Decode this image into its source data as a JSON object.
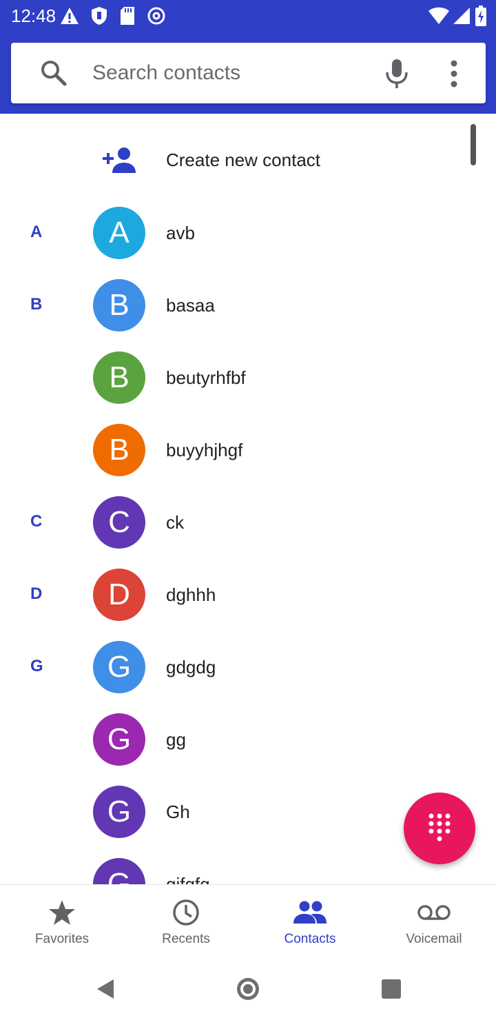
{
  "status_bar": {
    "time": "12:48",
    "left_icons": [
      "alert-icon",
      "shield-icon",
      "sd-card-icon",
      "sync-icon"
    ],
    "right_icons": [
      "wifi-icon",
      "signal-icon",
      "battery-charging-icon"
    ]
  },
  "search": {
    "placeholder": "Search contacts",
    "value": ""
  },
  "create_contact": {
    "label": "Create new contact"
  },
  "contacts": [
    {
      "letter": "A",
      "initial": "A",
      "name": "avb",
      "color": "#1ea8e0"
    },
    {
      "letter": "B",
      "initial": "B",
      "name": "basaa",
      "color": "#3f8ee8"
    },
    {
      "letter": "",
      "initial": "B",
      "name": "beutyrhfbf",
      "color": "#5aa33e"
    },
    {
      "letter": "",
      "initial": "B",
      "name": "buyyhjhgf",
      "color": "#ef6c00"
    },
    {
      "letter": "C",
      "initial": "C",
      "name": "ck",
      "color": "#6237b3"
    },
    {
      "letter": "D",
      "initial": "D",
      "name": "dghhh",
      "color": "#db4437"
    },
    {
      "letter": "G",
      "initial": "G",
      "name": "gdgdg",
      "color": "#3f8ee8"
    },
    {
      "letter": "",
      "initial": "G",
      "name": "gg",
      "color": "#9c27b0"
    },
    {
      "letter": "",
      "initial": "G",
      "name": "Gh",
      "color": "#6237b3"
    },
    {
      "letter": "",
      "initial": "G",
      "name": "gjfgfg",
      "color": "#6237b3"
    }
  ],
  "bottom_nav": [
    {
      "label": "Favorites",
      "icon": "star-icon",
      "active": false
    },
    {
      "label": "Recents",
      "icon": "clock-icon",
      "active": false
    },
    {
      "label": "Contacts",
      "icon": "people-icon",
      "active": true
    },
    {
      "label": "Voicemail",
      "icon": "voicemail-icon",
      "active": false
    }
  ],
  "colors": {
    "header": "#2f3fc6",
    "accent": "#2f3fc6",
    "fab": "#e8175d"
  }
}
